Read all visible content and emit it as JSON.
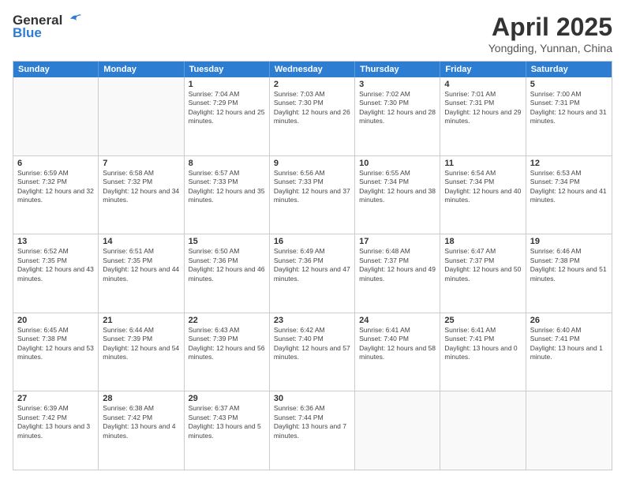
{
  "logo": {
    "line1": "General",
    "line2": "Blue"
  },
  "title": "April 2025",
  "subtitle": "Yongding, Yunnan, China",
  "weekdays": [
    "Sunday",
    "Monday",
    "Tuesday",
    "Wednesday",
    "Thursday",
    "Friday",
    "Saturday"
  ],
  "rows": [
    [
      {
        "day": "",
        "info": ""
      },
      {
        "day": "",
        "info": ""
      },
      {
        "day": "1",
        "info": "Sunrise: 7:04 AM\nSunset: 7:29 PM\nDaylight: 12 hours and 25 minutes."
      },
      {
        "day": "2",
        "info": "Sunrise: 7:03 AM\nSunset: 7:30 PM\nDaylight: 12 hours and 26 minutes."
      },
      {
        "day": "3",
        "info": "Sunrise: 7:02 AM\nSunset: 7:30 PM\nDaylight: 12 hours and 28 minutes."
      },
      {
        "day": "4",
        "info": "Sunrise: 7:01 AM\nSunset: 7:31 PM\nDaylight: 12 hours and 29 minutes."
      },
      {
        "day": "5",
        "info": "Sunrise: 7:00 AM\nSunset: 7:31 PM\nDaylight: 12 hours and 31 minutes."
      }
    ],
    [
      {
        "day": "6",
        "info": "Sunrise: 6:59 AM\nSunset: 7:32 PM\nDaylight: 12 hours and 32 minutes."
      },
      {
        "day": "7",
        "info": "Sunrise: 6:58 AM\nSunset: 7:32 PM\nDaylight: 12 hours and 34 minutes."
      },
      {
        "day": "8",
        "info": "Sunrise: 6:57 AM\nSunset: 7:33 PM\nDaylight: 12 hours and 35 minutes."
      },
      {
        "day": "9",
        "info": "Sunrise: 6:56 AM\nSunset: 7:33 PM\nDaylight: 12 hours and 37 minutes."
      },
      {
        "day": "10",
        "info": "Sunrise: 6:55 AM\nSunset: 7:34 PM\nDaylight: 12 hours and 38 minutes."
      },
      {
        "day": "11",
        "info": "Sunrise: 6:54 AM\nSunset: 7:34 PM\nDaylight: 12 hours and 40 minutes."
      },
      {
        "day": "12",
        "info": "Sunrise: 6:53 AM\nSunset: 7:34 PM\nDaylight: 12 hours and 41 minutes."
      }
    ],
    [
      {
        "day": "13",
        "info": "Sunrise: 6:52 AM\nSunset: 7:35 PM\nDaylight: 12 hours and 43 minutes."
      },
      {
        "day": "14",
        "info": "Sunrise: 6:51 AM\nSunset: 7:35 PM\nDaylight: 12 hours and 44 minutes."
      },
      {
        "day": "15",
        "info": "Sunrise: 6:50 AM\nSunset: 7:36 PM\nDaylight: 12 hours and 46 minutes."
      },
      {
        "day": "16",
        "info": "Sunrise: 6:49 AM\nSunset: 7:36 PM\nDaylight: 12 hours and 47 minutes."
      },
      {
        "day": "17",
        "info": "Sunrise: 6:48 AM\nSunset: 7:37 PM\nDaylight: 12 hours and 49 minutes."
      },
      {
        "day": "18",
        "info": "Sunrise: 6:47 AM\nSunset: 7:37 PM\nDaylight: 12 hours and 50 minutes."
      },
      {
        "day": "19",
        "info": "Sunrise: 6:46 AM\nSunset: 7:38 PM\nDaylight: 12 hours and 51 minutes."
      }
    ],
    [
      {
        "day": "20",
        "info": "Sunrise: 6:45 AM\nSunset: 7:38 PM\nDaylight: 12 hours and 53 minutes."
      },
      {
        "day": "21",
        "info": "Sunrise: 6:44 AM\nSunset: 7:39 PM\nDaylight: 12 hours and 54 minutes."
      },
      {
        "day": "22",
        "info": "Sunrise: 6:43 AM\nSunset: 7:39 PM\nDaylight: 12 hours and 56 minutes."
      },
      {
        "day": "23",
        "info": "Sunrise: 6:42 AM\nSunset: 7:40 PM\nDaylight: 12 hours and 57 minutes."
      },
      {
        "day": "24",
        "info": "Sunrise: 6:41 AM\nSunset: 7:40 PM\nDaylight: 12 hours and 58 minutes."
      },
      {
        "day": "25",
        "info": "Sunrise: 6:41 AM\nSunset: 7:41 PM\nDaylight: 13 hours and 0 minutes."
      },
      {
        "day": "26",
        "info": "Sunrise: 6:40 AM\nSunset: 7:41 PM\nDaylight: 13 hours and 1 minute."
      }
    ],
    [
      {
        "day": "27",
        "info": "Sunrise: 6:39 AM\nSunset: 7:42 PM\nDaylight: 13 hours and 3 minutes."
      },
      {
        "day": "28",
        "info": "Sunrise: 6:38 AM\nSunset: 7:42 PM\nDaylight: 13 hours and 4 minutes."
      },
      {
        "day": "29",
        "info": "Sunrise: 6:37 AM\nSunset: 7:43 PM\nDaylight: 13 hours and 5 minutes."
      },
      {
        "day": "30",
        "info": "Sunrise: 6:36 AM\nSunset: 7:44 PM\nDaylight: 13 hours and 7 minutes."
      },
      {
        "day": "",
        "info": ""
      },
      {
        "day": "",
        "info": ""
      },
      {
        "day": "",
        "info": ""
      }
    ]
  ]
}
